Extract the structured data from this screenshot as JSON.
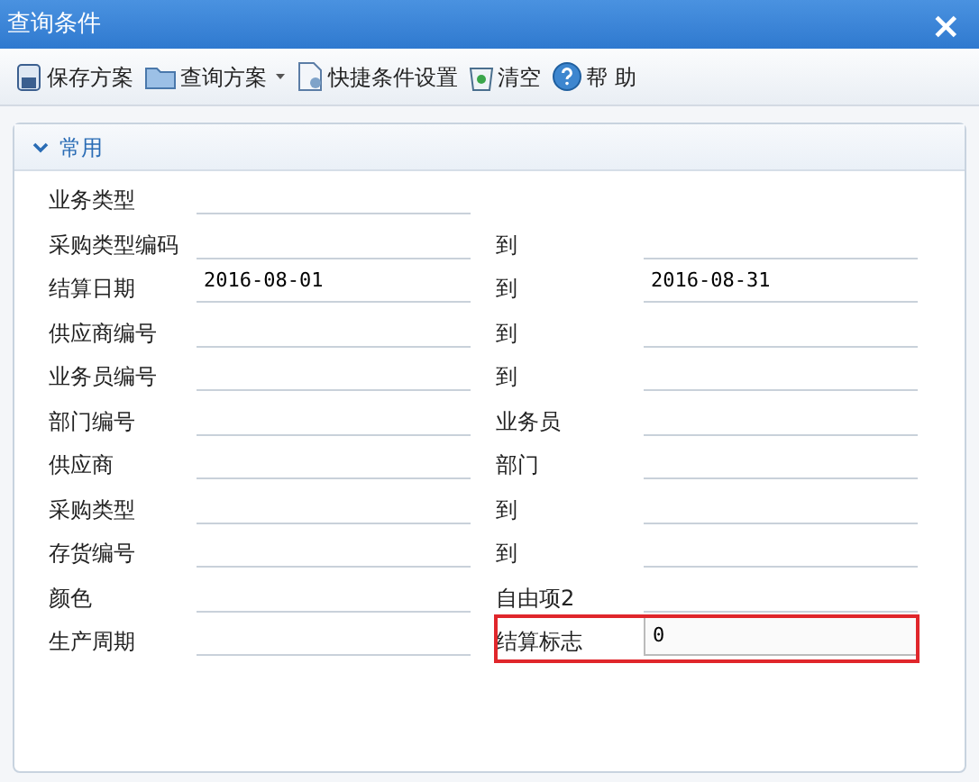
{
  "window": {
    "title": "查询条件",
    "close": "×"
  },
  "toolbar": [
    {
      "label": "保存方案",
      "kind": "save"
    },
    {
      "label": "查询方案",
      "kind": "folder",
      "dropdown": true
    },
    {
      "label": "快捷条件设置",
      "kind": "doc"
    },
    {
      "label": "清空",
      "kind": "bin"
    },
    {
      "label": "帮 助",
      "kind": "help"
    }
  ],
  "panel": {
    "title": "常用",
    "expanded": true,
    "rows": [
      {
        "left": {
          "label": "业务类型"
        }
      },
      {
        "left": {
          "label": "采购类型编码"
        },
        "right": {
          "label": "到",
          "highlighted": false
        }
      },
      {
        "left": {
          "label": "结算日期",
          "value": "2016-08-01"
        },
        "right": {
          "label": "到",
          "value": "2016-08-31",
          "highlighted": false
        }
      },
      {
        "left": {
          "label": "供应商编号"
        },
        "right": {
          "label": "到",
          "highlighted": false
        }
      },
      {
        "left": {
          "label": "业务员编号"
        },
        "right": {
          "label": "到",
          "highlighted": false
        }
      },
      {
        "left": {
          "label": "部门编号"
        },
        "right": {
          "label": "业务员",
          "highlighted": false
        }
      },
      {
        "left": {
          "label": "供应商"
        },
        "right": {
          "label": "部门",
          "highlighted": false
        }
      },
      {
        "left": {
          "label": "采购类型"
        },
        "right": {
          "label": "到",
          "highlighted": false
        }
      },
      {
        "left": {
          "label": "存货编号"
        },
        "right": {
          "label": "到",
          "highlighted": false
        }
      },
      {
        "left": {
          "label": "颜色"
        },
        "right": {
          "label": "自由项2",
          "highlighted": false
        }
      },
      {
        "left": {
          "label": "生产周期"
        },
        "right": {
          "label": "结算标志",
          "value": "0",
          "highlighted": true
        }
      }
    ]
  }
}
